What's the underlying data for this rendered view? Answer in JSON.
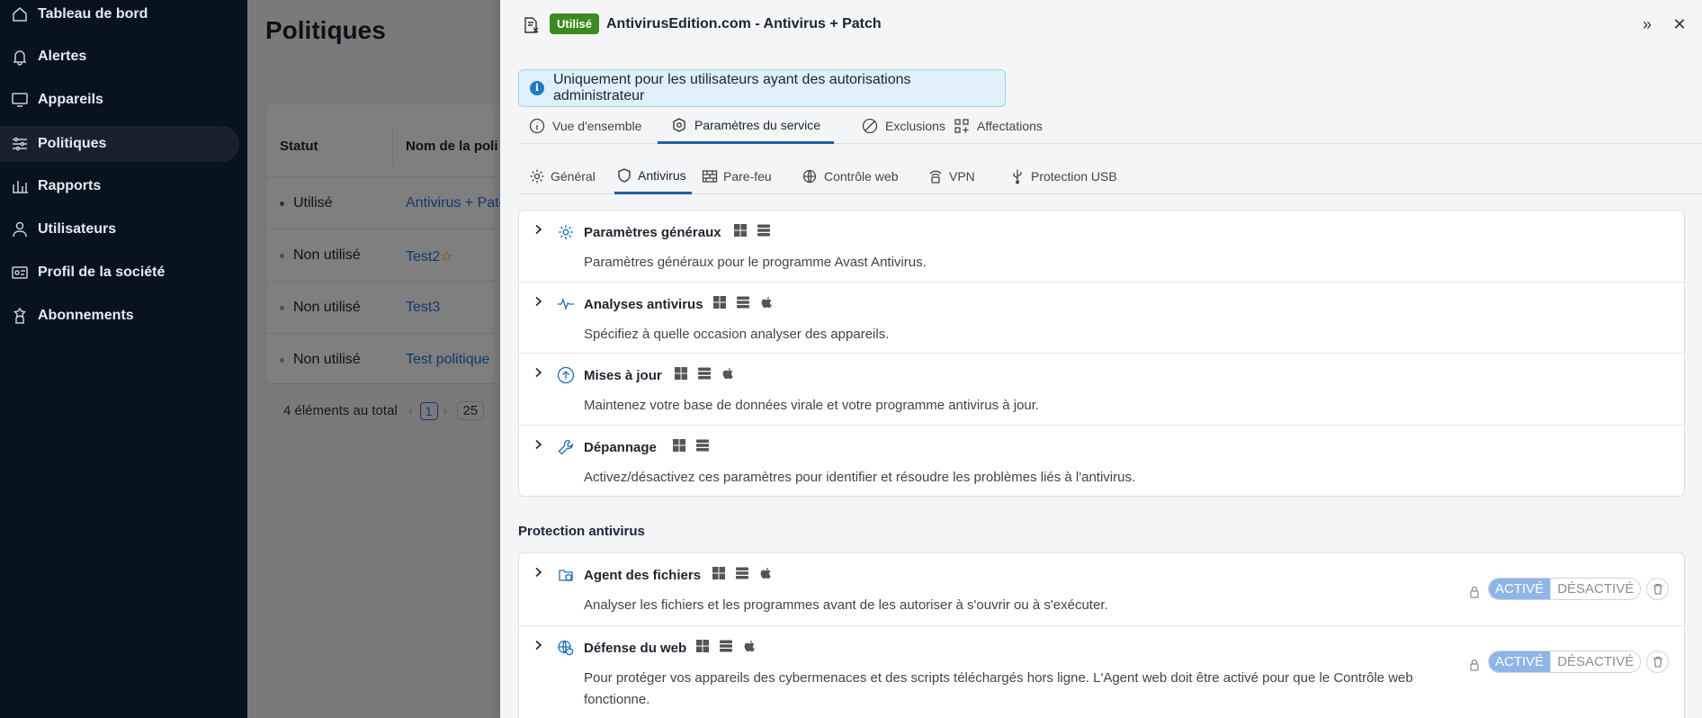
{
  "sidebar": {
    "items": [
      {
        "label": "Tableau de bord",
        "icon": "home-icon"
      },
      {
        "label": "Alertes",
        "icon": "bell-icon"
      },
      {
        "label": "Appareils",
        "icon": "monitor-icon"
      },
      {
        "label": "Politiques",
        "icon": "sliders-icon",
        "active": true
      },
      {
        "label": "Rapports",
        "icon": "bar-chart-icon"
      },
      {
        "label": "Utilisateurs",
        "icon": "user-icon"
      },
      {
        "label": "Profil de la société",
        "icon": "id-card-icon"
      },
      {
        "label": "Abonnements",
        "icon": "award-icon"
      }
    ]
  },
  "page": {
    "title": "Politiques",
    "table": {
      "headers": [
        "Statut",
        "Nom de la poli"
      ],
      "rows": [
        {
          "status": "Utilisé",
          "name": "Antivirus + Pate",
          "status_color": "#2e8b2e"
        },
        {
          "status": "Non utilisé",
          "name": "Test2",
          "starred": true
        },
        {
          "status": "Non utilisé",
          "name": "Test3"
        },
        {
          "status": "Non utilisé",
          "name": "Test politique"
        }
      ]
    },
    "pager": {
      "total": "4 éléments au total",
      "current": "1",
      "size": "25"
    }
  },
  "drawer": {
    "badge": "Utilisé",
    "title": "AntivirusEdition.com  -  Antivirus + Patch",
    "expand_glyph": "»",
    "close_glyph": "✕",
    "info_banner": "Uniquement pour les utilisateurs ayant des autorisations administrateur",
    "tabs": [
      {
        "label": "Vue d'ensemble",
        "icon": "info-circle-icon"
      },
      {
        "label": "Paramètres du service",
        "icon": "settings-box-icon",
        "active": true
      },
      {
        "label": "Exclusions",
        "icon": "ban-icon"
      },
      {
        "label": "Affectations",
        "icon": "grid-add-icon"
      }
    ],
    "subtabs": [
      {
        "label": "Général",
        "icon": "gear-icon"
      },
      {
        "label": "Antivirus",
        "icon": "shield-icon",
        "active": true
      },
      {
        "label": "Pare-feu",
        "icon": "firewall-icon"
      },
      {
        "label": "Contrôle web",
        "icon": "web-shield-icon"
      },
      {
        "label": "VPN",
        "icon": "vpn-icon"
      },
      {
        "label": "Protection USB",
        "icon": "usb-icon"
      }
    ],
    "settings": [
      {
        "title": "Paramètres généraux",
        "desc": "Paramètres généraux pour le programme Avast Antivirus.",
        "icon": "gear-icon",
        "os": [
          "windows",
          "server"
        ]
      },
      {
        "title": "Analyses antivirus",
        "desc": "Spécifiez à quelle occasion analyser des appareils.",
        "icon": "pulse-icon",
        "os": [
          "windows",
          "server",
          "apple"
        ]
      },
      {
        "title": "Mises à jour",
        "desc": "Maintenez votre base de données virale et votre programme antivirus à jour.",
        "icon": "arrow-up-circle-icon",
        "os": [
          "windows",
          "server",
          "apple"
        ]
      },
      {
        "title": "Dépannage",
        "desc": "Activez/désactivez ces paramètres pour identifier et résoudre les problèmes liés à l'antivirus.",
        "icon": "wrench-icon",
        "os": [
          "windows",
          "server"
        ]
      }
    ],
    "protection_section_title": "Protection antivirus",
    "protection": [
      {
        "title": "Agent des fichiers",
        "desc": "Analyser les fichiers et les programmes avant de les autoriser à s'ouvrir ou à s'exécuter.",
        "icon": "file-shield-icon",
        "os": [
          "windows",
          "server",
          "apple"
        ],
        "on_label": "ACTIVÉ",
        "off_label": "DÉSACTIVÉ",
        "state": "on"
      },
      {
        "title": "Défense du web",
        "desc": "Pour protéger vos appareils des cybermenaces et des scripts téléchargés hors ligne. L'Agent web doit être activé pour que le Contrôle web fonctionne.",
        "icon": "globe-shield-icon",
        "os": [
          "windows",
          "server",
          "apple"
        ],
        "on_label": "ACTIVÉ",
        "off_label": "DÉSACTIVÉ",
        "state": "on"
      }
    ]
  },
  "colors": {
    "accent": "#1f5fa8",
    "badge": "#3b8a1f",
    "link": "#2a6fd0",
    "toggle_on": "#8fb5e8"
  }
}
